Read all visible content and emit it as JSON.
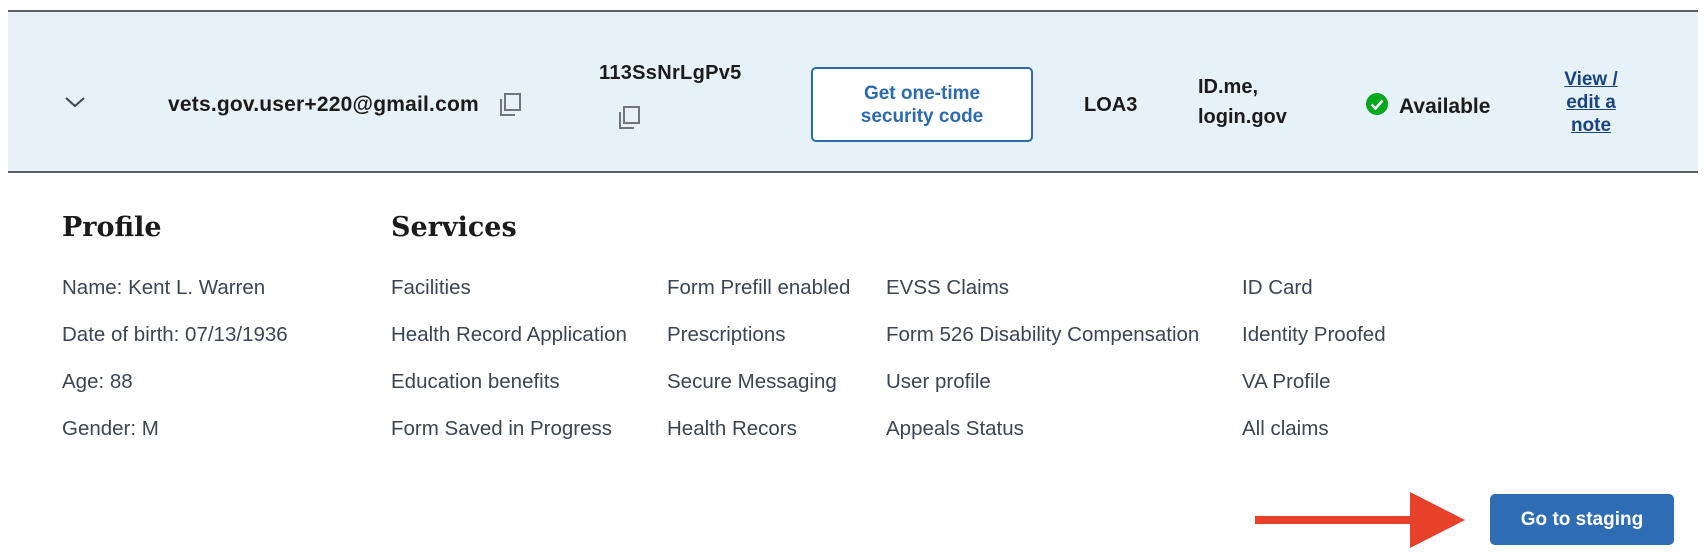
{
  "user_row": {
    "email": "vets.gov.user+220@gmail.com",
    "uuid": "113SsNrLgPv5",
    "otp_button_label_line1": "Get one-time",
    "otp_button_label_line2": "security code",
    "loa": "LOA3",
    "providers_line1": "ID.me,",
    "providers_line2": "login.gov",
    "status": "Available",
    "note_link_line1": "View /",
    "note_link_line2": "edit a",
    "note_link_line3": "note"
  },
  "profile": {
    "title": "Profile",
    "items": [
      "Name: Kent L. Warren",
      "Date of birth: 07/13/1936",
      "Age: 88",
      "Gender: M"
    ]
  },
  "services": {
    "title": "Services",
    "columns": [
      [
        "Facilities",
        "Health Record Application",
        "Education benefits",
        "Form Saved in Progress"
      ],
      [
        "Form Prefill enabled",
        "Prescriptions",
        "Secure Messaging",
        "Health Recors"
      ],
      [
        "EVSS Claims",
        "Form 526 Disability Compensation",
        "User profile",
        "Appeals Status"
      ],
      [
        "ID Card",
        "Identity Proofed",
        "VA Profile",
        "All claims"
      ]
    ]
  },
  "staging_button": "Go to staging",
  "icons": {
    "chevron": "chevron-down-icon",
    "copy": "copy-icon",
    "status": "check-circle-icon",
    "annotation": "arrow-right-icon"
  },
  "colors": {
    "row_bg": "#e7f2f8",
    "primary": "#2e6db4",
    "success": "#00a91c",
    "annotation_arrow": "#e8412a",
    "link": "#1a4480"
  }
}
